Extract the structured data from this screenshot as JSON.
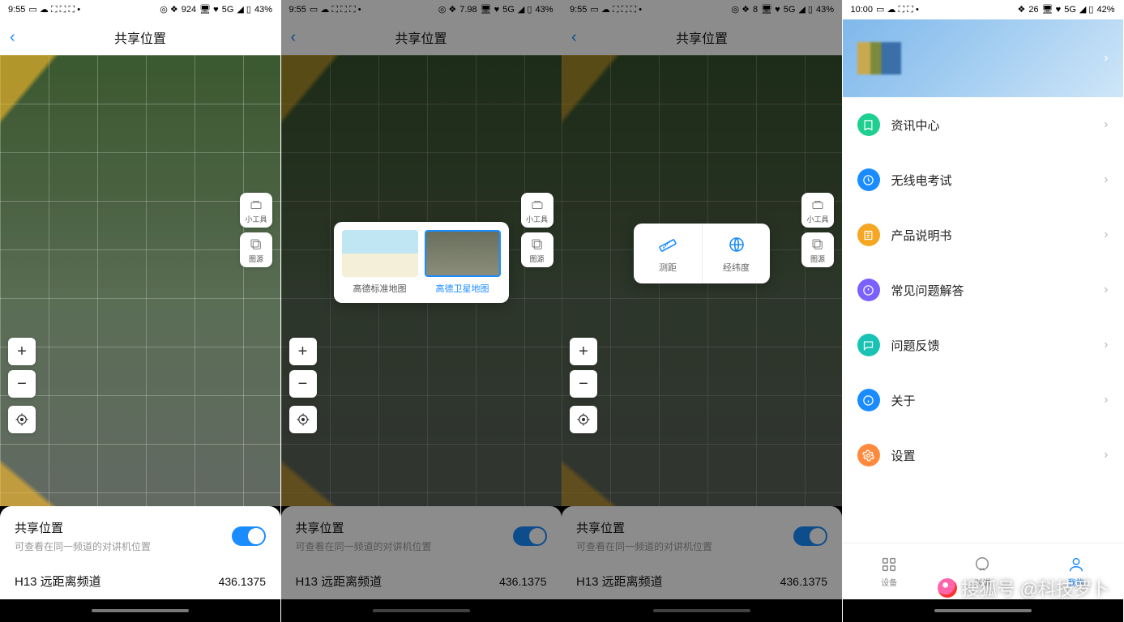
{
  "statusbar": {
    "time_a": "9:55",
    "time_b": "10:00",
    "net_a": "B/s",
    "net_spd1": "924",
    "net_spd2": "7.98",
    "net_spd3": "8",
    "net_spd4": "26",
    "signal": "5G",
    "battery_a": "43%",
    "battery_b": "42%"
  },
  "share": {
    "page_title": "共享位置",
    "title": "共享位置",
    "subtitle": "可查看在同一频道的对讲机位置",
    "channel": "H13 远距离频道",
    "freq": "436.1375"
  },
  "side": {
    "tools": "小工具",
    "layers": "图源"
  },
  "layers_popup": {
    "std": "高德标准地图",
    "sat": "高德卫星地图"
  },
  "tools_popup": {
    "measure": "测距",
    "latlng": "经纬度"
  },
  "profile_menu": [
    {
      "label": "资讯中心",
      "color": "#1fcf90"
    },
    {
      "label": "无线电考试",
      "color": "#1a8cff"
    },
    {
      "label": "产品说明书",
      "color": "#f5a623"
    },
    {
      "label": "常见问题解答",
      "color": "#7b61ff"
    },
    {
      "label": "问题反馈",
      "color": "#19c3b3"
    },
    {
      "label": "关于",
      "color": "#1a8cff"
    },
    {
      "label": "设置",
      "color": "#ff8a3d"
    }
  ],
  "tabs": {
    "device": "设备",
    "talk": "对讲",
    "mine": "我的"
  },
  "watermark": "搜狐号 @科技罗卜"
}
